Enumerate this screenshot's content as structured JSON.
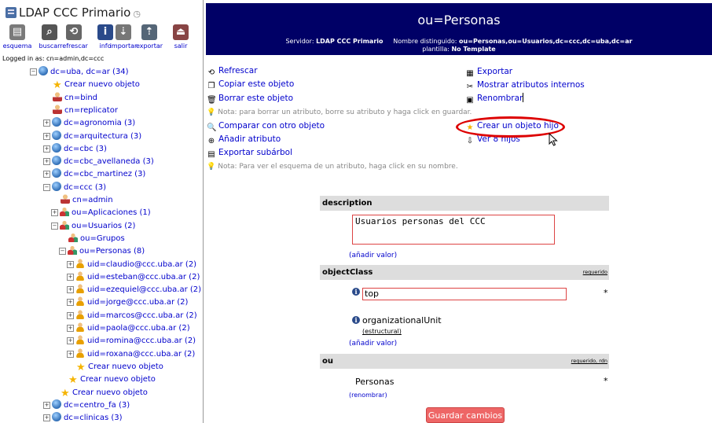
{
  "server": {
    "name": "LDAP CCC Primario",
    "clock_icon": "clock-icon"
  },
  "toolbar": [
    {
      "label": "esquema",
      "icon": "schema-icon",
      "color": "#7a7a7a"
    },
    {
      "label": "buscar",
      "icon": "search-icon",
      "color": "#555555"
    },
    {
      "label": "refrescar",
      "icon": "refresh-icon",
      "color": "#666666"
    },
    {
      "label": "info",
      "icon": "info-icon",
      "color": "#2a4a8a"
    },
    {
      "label": "importar",
      "icon": "import-icon",
      "color": "#777777"
    },
    {
      "label": "exportar",
      "icon": "export-icon",
      "color": "#556677"
    },
    {
      "label": "salir",
      "icon": "logout-icon",
      "color": "#884444"
    }
  ],
  "logged_in": "Logged in as: cn=admin,dc=ccc",
  "tree": [
    {
      "label": "dc=uba, dc=ar (34)",
      "icon": "globe",
      "expander": "−",
      "level": 0
    },
    {
      "label": "Crear nuevo objeto",
      "icon": "star",
      "expander": "",
      "level": 1
    },
    {
      "label": "cn=bind",
      "icon": "person",
      "expander": "",
      "level": 1
    },
    {
      "label": "cn=replicator",
      "icon": "person",
      "expander": "",
      "level": 1
    },
    {
      "label": "dc=agronomia (3)",
      "icon": "globe",
      "expander": "+",
      "level": 1
    },
    {
      "label": "dc=arquitectura (3)",
      "icon": "globe",
      "expander": "+",
      "level": 1
    },
    {
      "label": "dc=cbc (3)",
      "icon": "globe",
      "expander": "+",
      "level": 1
    },
    {
      "label": "dc=cbc_avellaneda (3)",
      "icon": "globe",
      "expander": "+",
      "level": 1
    },
    {
      "label": "dc=cbc_martinez (3)",
      "icon": "globe",
      "expander": "+",
      "level": 1
    },
    {
      "label": "dc=ccc (3)",
      "icon": "globe",
      "expander": "−",
      "level": 1
    },
    {
      "label": "cn=admin",
      "icon": "person",
      "expander": "",
      "level": 2
    },
    {
      "label": "ou=Aplicaciones (1)",
      "icon": "ou",
      "expander": "+",
      "level": 2
    },
    {
      "label": "ou=Usuarios (2)",
      "icon": "ou",
      "expander": "−",
      "level": 2
    },
    {
      "label": "ou=Grupos",
      "icon": "ou",
      "expander": "",
      "level": 3
    },
    {
      "label": "ou=Personas (8)",
      "icon": "ou",
      "expander": "−",
      "level": 3
    },
    {
      "label": "uid=claudio@ccc.uba.ar (2)",
      "icon": "user",
      "expander": "+",
      "level": 4
    },
    {
      "label": "uid=esteban@ccc.uba.ar (2)",
      "icon": "user",
      "expander": "+",
      "level": 4
    },
    {
      "label": "uid=ezequiel@ccc.uba.ar (2)",
      "icon": "user",
      "expander": "+",
      "level": 4
    },
    {
      "label": "uid=jorge@ccc.uba.ar (2)",
      "icon": "user",
      "expander": "+",
      "level": 4
    },
    {
      "label": "uid=marcos@ccc.uba.ar (2)",
      "icon": "user",
      "expander": "+",
      "level": 4
    },
    {
      "label": "uid=paola@ccc.uba.ar (2)",
      "icon": "user",
      "expander": "+",
      "level": 4
    },
    {
      "label": "uid=romina@ccc.uba.ar (2)",
      "icon": "user",
      "expander": "+",
      "level": 4
    },
    {
      "label": "uid=roxana@ccc.uba.ar (2)",
      "icon": "user",
      "expander": "+",
      "level": 4
    },
    {
      "label": "Crear nuevo objeto",
      "icon": "star",
      "expander": "",
      "level": 4
    },
    {
      "label": "Crear nuevo objeto",
      "icon": "star",
      "expander": "",
      "level": 3
    },
    {
      "label": "Crear nuevo objeto",
      "icon": "star",
      "expander": "",
      "level": 2
    },
    {
      "label": "dc=centro_fa (3)",
      "icon": "globe",
      "expander": "+",
      "level": 1
    },
    {
      "label": "dc=clinicas (3)",
      "icon": "globe",
      "expander": "+",
      "level": 1
    }
  ],
  "header": {
    "title": "ou=Personas",
    "server_label": "Servidor:",
    "server_value": "LDAP CCC Primario",
    "dn_label": "Nombre distinguido:",
    "dn_value": "ou=Personas,ou=Usuarios,dc=ccc,dc=uba,dc=ar",
    "template_label": "plantilla:",
    "template_value": "No Template"
  },
  "actions_left": {
    "refresh": "Refrescar",
    "copy": "Copiar este objeto",
    "delete": "Borrar este objeto",
    "note_delete": "Nota: para borrar un atributo, borre su atributo y haga click en guardar.",
    "compare": "Comparar con otro objeto",
    "add_attr": "Añadir atributo",
    "export_subtree": "Exportar subárbol",
    "note_schema": "Nota: Para ver el esquema de un atributo, haga click en su nombre."
  },
  "actions_right": {
    "export": "Exportar",
    "show_internal": "Mostrar atributos internos",
    "rename": "Renombrar",
    "create_child": "Crear un objeto hijo",
    "view_children": "Ver 8 hijos"
  },
  "attributes": {
    "description": {
      "name": "description",
      "value": "Usuarios personas del CCC",
      "add_value": "(añadir valor)"
    },
    "objectclass": {
      "name": "objectClass",
      "required": "requerido",
      "values": [
        "top",
        "organizationalUnit"
      ],
      "structural": "(estructural)",
      "add_value": "(añadir valor)"
    },
    "ou": {
      "name": "ou",
      "required": "requerido, rdn",
      "value": "Personas",
      "rename": "(renombrar)"
    }
  },
  "save_button": "Guardar cambios",
  "colors": {
    "header_bg": "#000066",
    "link": "#0000cc",
    "attr_head_bg": "#dddddd",
    "highlight": "#dd0000",
    "save_button": "#ee6666"
  }
}
